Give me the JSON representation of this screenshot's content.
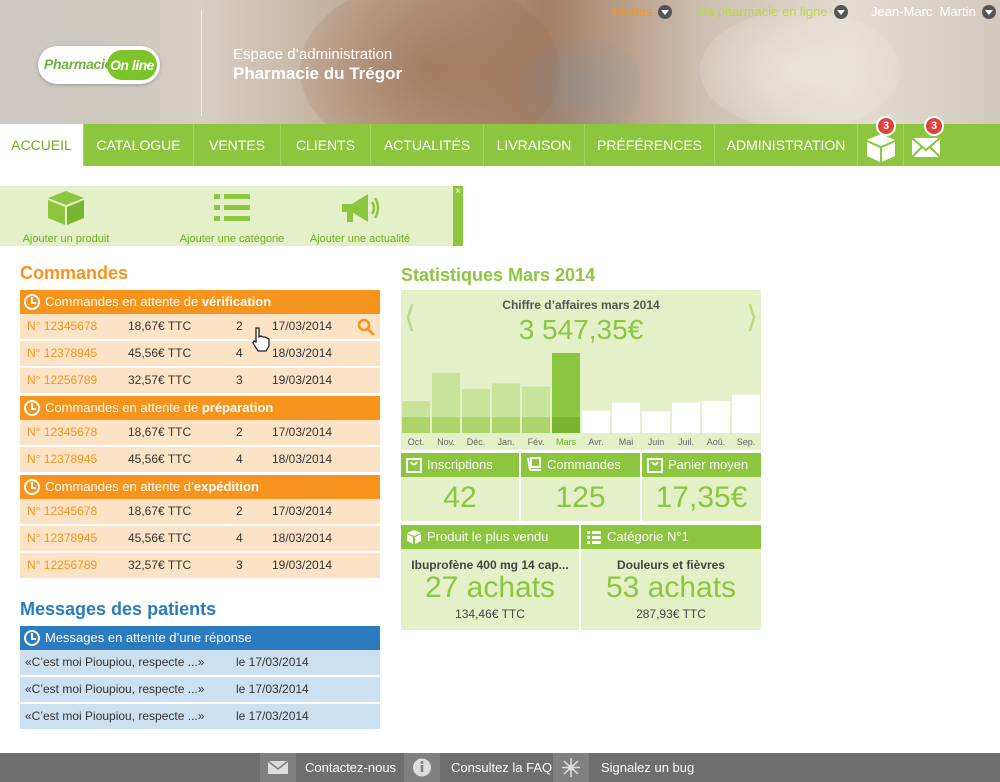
{
  "header": {
    "logo": {
      "part1": "Pharmacie",
      "part2": "On line"
    },
    "subtitle": "Espace d’administration",
    "pharmacy_name": "Pharmacie du Trégor",
    "top_menu": {
      "alerts": "Alertes",
      "my_pharmacy": "Ma pharmacie en ligne",
      "user": "Jean-Marc  Martin"
    }
  },
  "nav": {
    "items": [
      {
        "label": "ACCUEIL",
        "active": true
      },
      {
        "label": "CATALOGUE"
      },
      {
        "label": "VENTES"
      },
      {
        "label": "CLIENTS"
      },
      {
        "label": "ACTUALITÉS"
      },
      {
        "label": "LIVRAISON"
      },
      {
        "label": "PRÉFÉRENCES"
      },
      {
        "label": "ADMINISTRATION"
      }
    ],
    "box_badge": "3",
    "mail_badge": "3"
  },
  "quick_actions": {
    "add_product": "Ajouter un produit",
    "add_category": "Ajouter une catégorie",
    "add_news": "Ajouter une actualité",
    "close": "×"
  },
  "orders": {
    "title": "Commandes",
    "groups": [
      {
        "prefix": "Commandes en attente de ",
        "strong": "vérification",
        "rows": [
          {
            "id": "N° 12345678",
            "amount": "18,67€ TTC",
            "qty": "2",
            "date": "17/03/2014"
          },
          {
            "id": "N° 12378945",
            "amount": "45,56€ TTC",
            "qty": "4",
            "date": "18/03/2014"
          },
          {
            "id": "N° 12256789",
            "amount": "32,57€ TTC",
            "qty": "3",
            "date": "19/03/2014"
          }
        ]
      },
      {
        "prefix": "Commandes en attente de ",
        "strong": "préparation",
        "rows": [
          {
            "id": "N° 12345678",
            "amount": "18,67€ TTC",
            "qty": "2",
            "date": "17/03/2014"
          },
          {
            "id": "N° 12378945",
            "amount": "45,56€ TTC",
            "qty": "4",
            "date": "18/03/2014"
          }
        ]
      },
      {
        "prefix": "Commandes en attente d’",
        "strong": "expédition",
        "rows": [
          {
            "id": "N° 12345678",
            "amount": "18,67€ TTC",
            "qty": "2",
            "date": "17/03/2014"
          },
          {
            "id": "N° 12378945",
            "amount": "45,56€ TTC",
            "qty": "4",
            "date": "18/03/2014"
          },
          {
            "id": "N° 12256789",
            "amount": "32,57€ TTC",
            "qty": "3",
            "date": "19/03/2014"
          }
        ]
      }
    ]
  },
  "messages": {
    "title": "Messages des patients",
    "group_label": "Messages en attente d’une réponse",
    "rows": [
      {
        "text": "«C’est moi Pioupiou, respecte ...»",
        "date": "le 17/03/2014"
      },
      {
        "text": "«C’est moi Pioupiou, respecte ...»",
        "date": "le 17/03/2014"
      },
      {
        "text": "«C’est moi Pioupiou, respecte ...»",
        "date": "le 17/03/2014"
      }
    ]
  },
  "stats": {
    "title": "Statistiques Mars 2014",
    "revenue_title": "Chiffre d’affaires mars 2014",
    "revenue_amount": "3 547,35€",
    "prev_arrow": "⟨",
    "next_arrow": "⟩",
    "inscriptions_label": "Inscriptions",
    "inscriptions_value": "42",
    "commandes_label": "Commandes",
    "commandes_value": "125",
    "panier_label": "Panier moyen",
    "panier_value": "17,35€",
    "top_product_label": "Produit le plus vendu",
    "top_product_name": "Ibuprofène 400 mg 14 cap...",
    "top_product_qty": "27 achats",
    "top_product_price": "134,46€ TTC",
    "top_category_label": "Catégorie N°1",
    "top_category_name": "Douleurs et fièvres",
    "top_category_qty": "53 achats",
    "top_category_price": "287,93€ TTC"
  },
  "chart_data": {
    "type": "bar",
    "categories": [
      "Oct.",
      "Nov.",
      "Déc.",
      "Jan.",
      "Fév.",
      "Mars",
      "Avr.",
      "Mai",
      "Juin",
      "Juil.",
      "Aoû.",
      "Sep."
    ],
    "series": [
      {
        "values": [
          0.4,
          0.75,
          0.55,
          0.62,
          0.58,
          1.0,
          0.28,
          0.38,
          0.27,
          0.38,
          0.4,
          0.48
        ]
      },
      {
        "values": [
          0.2,
          0.2,
          0.2,
          0.2,
          0.2,
          0.2,
          0,
          0,
          0,
          0,
          0,
          0
        ]
      }
    ],
    "highlight": "Mars",
    "colors": {
      "past": "#c8e39a",
      "past_low": "#add46a",
      "current": "#8cc63f",
      "future": "#ffffff"
    }
  },
  "footer": {
    "contact": "Contactez-nous",
    "faq": "Consultez la FAQ",
    "bug": "Signalez un bug"
  }
}
